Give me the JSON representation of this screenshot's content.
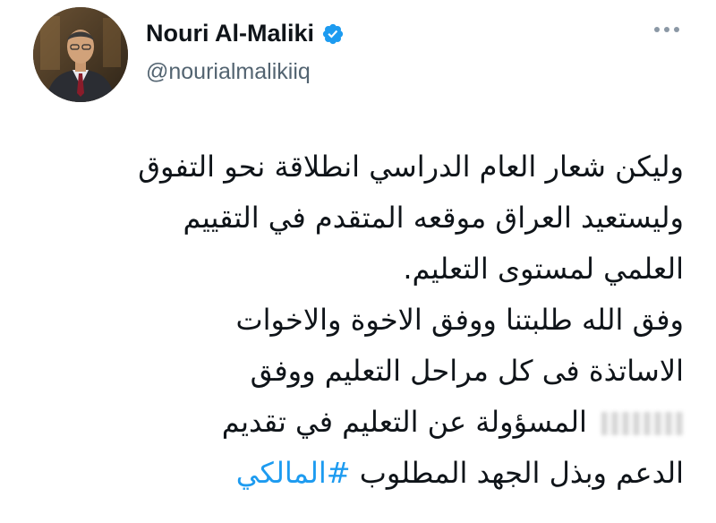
{
  "profile": {
    "display_name": "Nouri Al-Maliki",
    "handle": "@nourialmalikiiq",
    "verified": true,
    "avatar_icon": "profile-photo",
    "more_icon": "more-dots-icon"
  },
  "tweet": {
    "lines": [
      "وليكن شعار العام الدراسي انطلاقة نحو التفوق",
      "وليستعيد العراق موقعه المتقدم في التقييم",
      "العلمي لمستوى التعليم.",
      "وفق الله طلبتنا ووفق الاخوة والاخوات",
      "الاساتذة فى كل مراحل التعليم ووفق",
      "المسؤولة عن التعليم في تقديم",
      "الدعم وبذل الجهد المطلوب"
    ],
    "hashtag": "#المالكي"
  },
  "colors": {
    "link": "#1d9bf0",
    "verified_badge": "#1d9bf0",
    "secondary_text": "#536471"
  }
}
